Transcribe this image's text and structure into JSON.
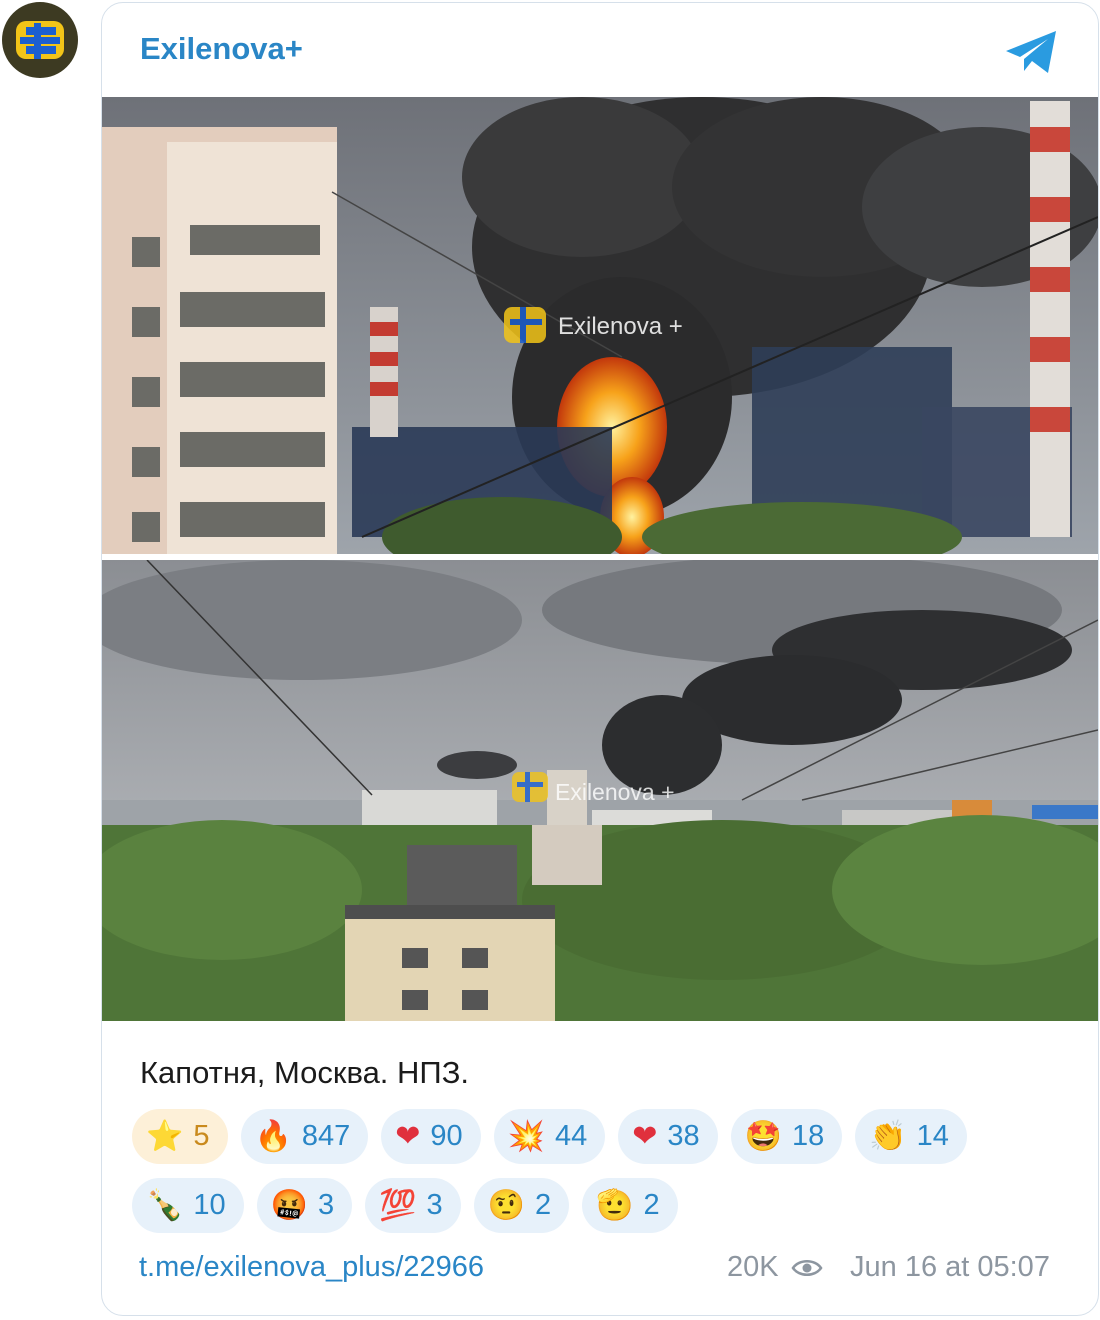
{
  "channel": {
    "name": "Exilenova+",
    "watermark": "Exilenova +"
  },
  "post": {
    "caption": "Капотня, Москва. НПЗ.",
    "link": "t.me/exilenova_plus/22966",
    "views": "20K",
    "date": "Jun 16 at 05:07"
  },
  "reactions": [
    {
      "emoji": "⭐",
      "count": "5"
    },
    {
      "emoji": "🔥",
      "count": "847"
    },
    {
      "emoji": "❤",
      "count": "90"
    },
    {
      "emoji": "💥",
      "count": "44"
    },
    {
      "emoji": "❤",
      "count": "38"
    },
    {
      "emoji": "🤩",
      "count": "18"
    },
    {
      "emoji": "👏",
      "count": "14"
    },
    {
      "emoji": "🍾",
      "count": "10"
    },
    {
      "emoji": "🤬",
      "count": "3"
    },
    {
      "emoji": "💯",
      "count": "3"
    },
    {
      "emoji": "🤨",
      "count": "2"
    },
    {
      "emoji": "🫡",
      "count": "2"
    }
  ],
  "colors": {
    "accent": "#2a86c6",
    "chip_bg": "#e7f1fa",
    "star_chip_bg": "#fdf0d8",
    "muted": "#8d96a0"
  }
}
